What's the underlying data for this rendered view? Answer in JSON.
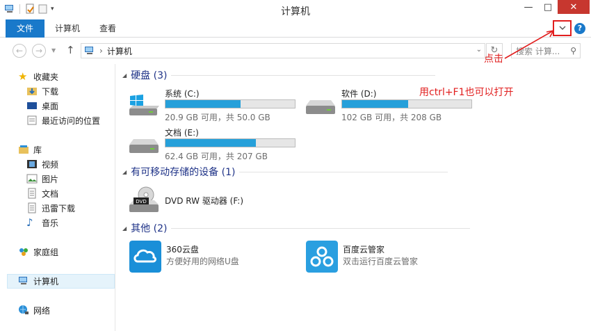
{
  "window": {
    "title": "计算机",
    "close": "✕",
    "minimize": "—",
    "maximize": "□"
  },
  "ribbon": {
    "tabs": [
      "文件",
      "计算机",
      "查看"
    ],
    "expand_icon": "chevron-down-icon",
    "help_label": "?"
  },
  "nav": {
    "address_path": "计算机",
    "search_placeholder": "搜索 计算...",
    "addr_arrow": "›"
  },
  "sidebar": {
    "favorites": {
      "label": "收藏夹",
      "items": [
        "下载",
        "桌面",
        "最近访问的位置"
      ]
    },
    "libraries": {
      "label": "库",
      "items": [
        "视频",
        "图片",
        "文档",
        "迅雷下载",
        "音乐"
      ]
    },
    "homegroup": "家庭组",
    "computer": "计算机",
    "network": "网络"
  },
  "groups": {
    "hard_disks": "硬盘 (3)",
    "removable": "有可移动存储的设备 (1)",
    "other": "其他 (2)"
  },
  "drives": [
    {
      "name": "系统 (C:)",
      "info": "20.9 GB 可用，共 50.0 GB",
      "used_fraction": 0.582,
      "icon": "windows-drive-icon"
    },
    {
      "name": "软件 (D:)",
      "info": "102 GB 可用，共 208 GB",
      "used_fraction": 0.51,
      "icon": "hard-drive-icon"
    },
    {
      "name": "文档 (E:)",
      "info": "62.4 GB 可用，共 207 GB",
      "used_fraction": 0.699,
      "icon": "hard-drive-icon"
    }
  ],
  "dvd": {
    "name": "DVD RW 驱动器 (F:)",
    "label": "DVD"
  },
  "apps": [
    {
      "name": "360云盘",
      "desc": "方便好用的网络U盘",
      "color": "#1a8fd8"
    },
    {
      "name": "百度云管家",
      "desc": "双击运行百度云管家",
      "color": "#2a9fe0"
    }
  ],
  "annotations": {
    "click": "点击",
    "tip": "用ctrl+F1也可以打开",
    "color": "#e11e1e"
  }
}
